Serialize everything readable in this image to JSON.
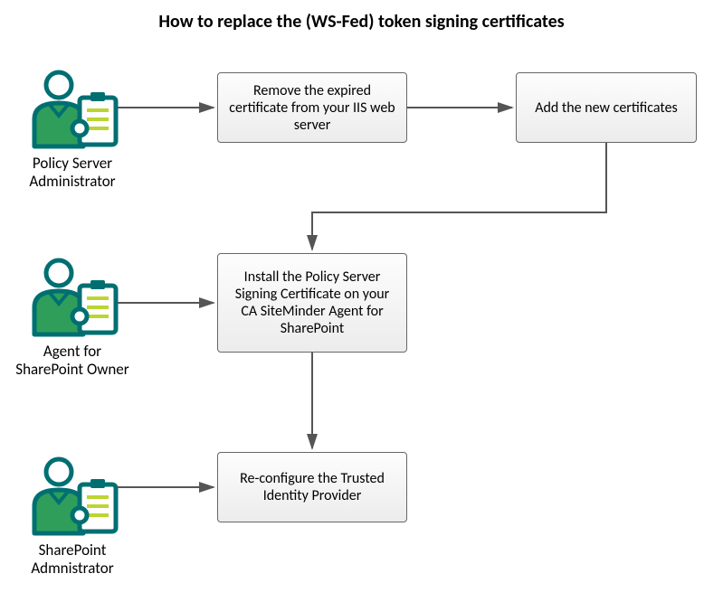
{
  "title": "How to replace the (WS-Fed) token signing certificates",
  "actors": {
    "policyServer": {
      "label": "Policy Server Administrator"
    },
    "agentOwner": {
      "label": "Agent for SharePoint Owner"
    },
    "sharepointAdmin": {
      "label": "SharePoint Admnistrator"
    }
  },
  "steps": {
    "removeExpired": {
      "label": "Remove the expired certificate from your IIS web server"
    },
    "addNew": {
      "label": "Add the new certificates"
    },
    "installPolicy": {
      "label": "Install the Policy Server Signing Certificate on your CA SiteMinder Agent for SharePoint"
    },
    "reconfigure": {
      "label": "Re-configure the Trusted Identity Provider"
    }
  },
  "colors": {
    "actorPrimary": "#2f9e5b",
    "actorSecondary": "#006f72",
    "actorAccent": "#bcd530",
    "arrow": "#555555"
  }
}
